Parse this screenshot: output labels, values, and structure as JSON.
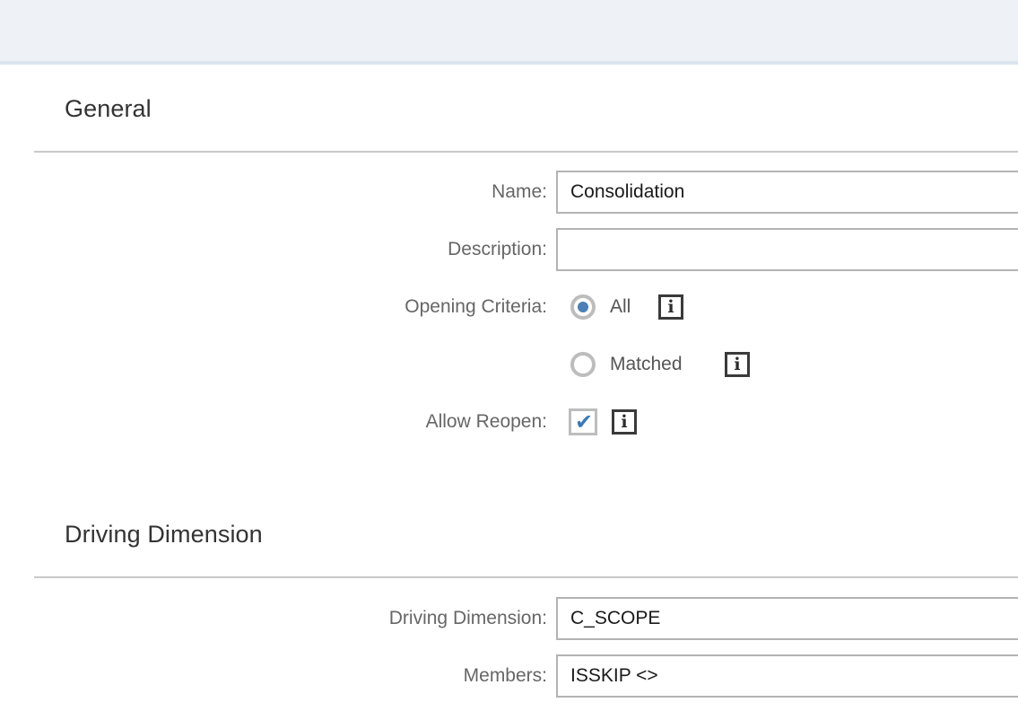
{
  "window": {
    "toolbar_strip": ""
  },
  "sections": [
    {
      "id": "general",
      "title": "General"
    },
    {
      "id": "driving_dimension",
      "title": "Driving Dimension"
    }
  ],
  "general": {
    "name": {
      "label": "Name:",
      "value": "Consolidation",
      "placeholder": ""
    },
    "description": {
      "label": "Description:",
      "value": "",
      "placeholder": ""
    },
    "opening_criteria": {
      "label": "Opening Criteria:",
      "options": [
        {
          "label": "All",
          "selected": true,
          "info": "i"
        },
        {
          "label": "Matched",
          "selected": false,
          "info": "i"
        }
      ]
    },
    "allow_reopen": {
      "label": "Allow Reopen:",
      "checked": true,
      "check_glyph": "✔",
      "info": "i"
    }
  },
  "driving_dimension": {
    "dimension": {
      "label": "Driving Dimension:",
      "value": "C_SCOPE",
      "placeholder": ""
    },
    "members": {
      "label": "Members:",
      "value": "ISSKIP <>",
      "placeholder": ""
    }
  },
  "colors": {
    "toolbar_bg": "#eef2f6",
    "toolbar_border": "#dbe5ef",
    "accent_blue": "#4a80b5",
    "check_blue": "#3d7ab5",
    "label_grey": "#666666",
    "rule_grey": "#c8c8c8",
    "input_border": "#b3b3b3",
    "heading_grey": "#333333"
  },
  "icons": {
    "info": "info-icon",
    "checkmark": "check-icon",
    "radio_selected": "radio-selected-icon",
    "radio_unselected": "radio-unselected-icon"
  }
}
